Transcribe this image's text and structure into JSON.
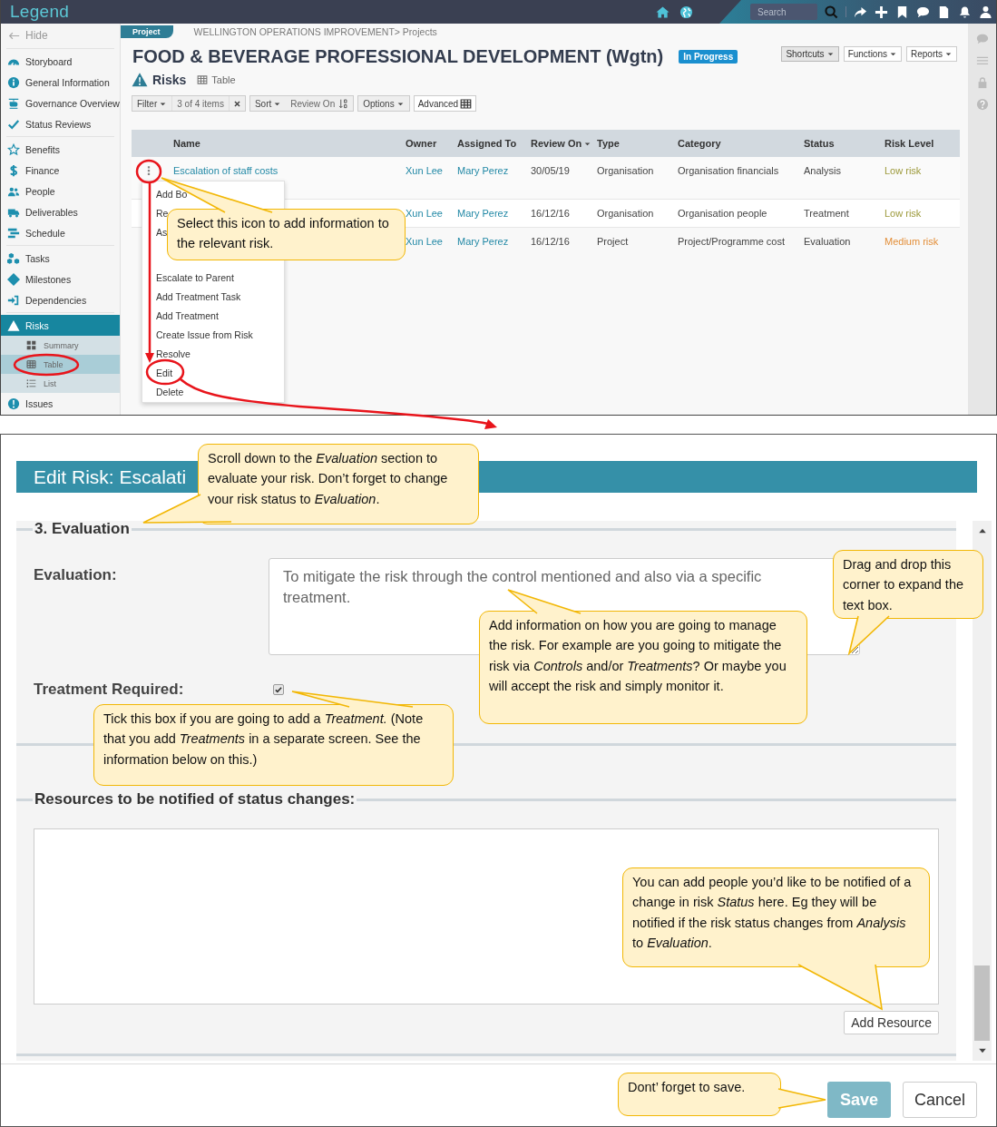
{
  "top_bar": {
    "logo": "Legend",
    "search": {
      "placeholder": "Search"
    }
  },
  "sidebar": {
    "hide": "Hide",
    "groups": [
      [
        {
          "label": "Storyboard",
          "selected": false
        },
        {
          "label": "General Information",
          "selected": false
        },
        {
          "label": "Governance Overview",
          "selected": false
        },
        {
          "label": "Status Reviews",
          "selected": false
        }
      ],
      [
        {
          "label": "Benefits",
          "selected": false
        },
        {
          "label": "Finance",
          "selected": false
        },
        {
          "label": "People",
          "selected": false
        },
        {
          "label": "Deliverables",
          "selected": false
        },
        {
          "label": "Schedule",
          "selected": false
        }
      ],
      [
        {
          "label": "Tasks",
          "selected": false
        },
        {
          "label": "Milestones",
          "selected": false
        },
        {
          "label": "Dependencies",
          "selected": false
        }
      ],
      [
        {
          "label": "Risks",
          "selected": true,
          "expanded": true,
          "children": [
            {
              "label": "Summary",
              "selected": false
            },
            {
              "label": "Table",
              "selected": true
            },
            {
              "label": "List",
              "selected": false
            }
          ]
        },
        {
          "label": "Issues",
          "selected": false
        }
      ]
    ]
  },
  "header": {
    "tab": "Project",
    "breadcrumb": "WELLINGTON OPERATIONS IMPROVEMENT> Projects",
    "title": "FOOD & BEVERAGE PROFESSIONAL DEVELOPMENT (Wgtn)",
    "status_badge": "In Progress",
    "buttons": [
      {
        "label": "Shortcuts",
        "active": true
      },
      {
        "label": "Functions",
        "active": false
      },
      {
        "label": "Reports",
        "active": false
      }
    ]
  },
  "section": {
    "title": "Risks",
    "view": "Table"
  },
  "toolbar": {
    "filter": "Filter",
    "filter_count": "3 of 4 items",
    "sort": "Sort",
    "sort_field": "Review On",
    "options": "Options",
    "advanced": "Advanced"
  },
  "table": {
    "columns": [
      {
        "label": "Name",
        "sorted": false
      },
      {
        "label": "Owner",
        "sorted": false
      },
      {
        "label": "Assigned To",
        "sorted": false
      },
      {
        "label": "Review On",
        "sorted": true
      },
      {
        "label": "Type",
        "sorted": false
      },
      {
        "label": "Category",
        "sorted": false
      },
      {
        "label": "Status",
        "sorted": false
      },
      {
        "label": "Risk Level",
        "sorted": false
      }
    ],
    "rows": [
      {
        "actions_icon": true,
        "name": "Escalation of staff costs",
        "owner": "Xun Lee",
        "assigned_to": "Mary Perez",
        "review_on": "30/05/19",
        "type": "Organisation",
        "category": "Organisation financials",
        "status": "Analysis",
        "risk_level": "Low risk",
        "color": "#9d9a3c"
      },
      {
        "owner": "Xun Lee",
        "assigned_to": "Mary Perez",
        "review_on": "16/12/16",
        "type": "Organisation",
        "category": "Organisation people",
        "status": "Treatment",
        "risk_level": "Low risk",
        "color": "#9d9a3c"
      },
      {
        "owner": "Xun Lee",
        "assigned_to": "Mary Perez",
        "review_on": "16/12/16",
        "type": "Project",
        "category": "Project/Programme cost",
        "status": "Evaluation",
        "risk_level": "Medium risk",
        "color": "#e38f3a"
      }
    ]
  },
  "context_menu": {
    "groups": [
      [
        "Add Bo",
        "Re",
        "As"
      ],
      [
        "Escalate to Parent",
        "Add Treatment Task",
        "Add Treatment",
        "Create Issue from Risk",
        "Resolve",
        "Edit",
        "Delete"
      ]
    ]
  },
  "edit_dialog": {
    "title": "Edit Risk: Escalati",
    "section": "3. Evaluation",
    "evaluation_label": "Evaluation:",
    "evaluation_value": "To mitigate the risk through the control mentioned and also via a specific treatment.",
    "treatment_label": "Treatment Required:",
    "treatment_required": true,
    "resources_label": "Resources to be notified of status changes:",
    "add_resource": "Add Resource",
    "save": "Save",
    "cancel": "Cancel"
  },
  "callouts": [
    {
      "text": "Select this icon to add information to the relevant risk."
    },
    {
      "text": "Scroll down to the *Evaluation* section to evaluate your risk.  Don’t forget to change your risk status to *Evaluation*."
    },
    {
      "text": "Drag and drop this corner to expand the text box."
    },
    {
      "text": "Add information on how you are going to manage the risk.  For example are you going to mitigate the risk via *Controls* and/or *Treatments*? Or maybe you will accept the risk and simply monitor it."
    },
    {
      "text": "Tick this box if you are going to add a *Treatment.* (Note that you add *Treatments* in a separate screen.  See the information below on this.)"
    },
    {
      "text": "You can add people you’d like to be notified of a change in risk *Status* here. Eg they will be notified if the risk status changes from *Analysis* to *Evaluation*."
    },
    {
      "text": "Dont’ forget to save."
    }
  ]
}
